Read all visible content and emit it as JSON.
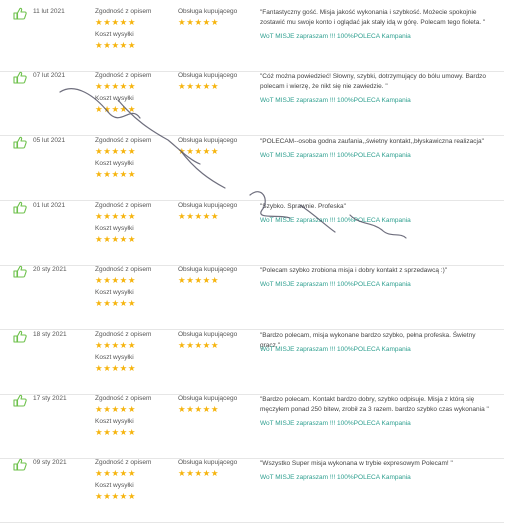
{
  "labels": {
    "accuracy": "Zgodność z opisem",
    "shipping": "Koszt wysyłki",
    "service": "Obsługa kupującego"
  },
  "stars": "★★★★★",
  "reviews": [
    {
      "date": "11 lut 2021",
      "comment": "\"Fantastyczny gość. Misja jakość wykonania i szybkość. Możecie spokojnie zostawić mu swoje konto i oglądać jak stały idą w górę. Polecam tego fioleta. \"",
      "campaign": "WoT MISJE zapraszam !!! 100%POLECA Kampania"
    },
    {
      "date": "07 lut 2021",
      "comment": "\"Cóż można powiedzieć! Słowny, szybki, dotrzymujący do bólu umowy. Bardzo polecam i wierzę, że nikt się nie zawiedzie. \"",
      "campaign": "WoT MISJE zapraszam !!! 100%POLECA Kampania"
    },
    {
      "date": "05 lut 2021",
      "comment": "\"POLECAM--osoba godna zaufania,,świetny kontakt,,błyskawiczna realizacja\"",
      "campaign": "WoT MISJE zapraszam !!! 100%POLECA Kampania"
    },
    {
      "date": "01 lut 2021",
      "comment": "\"Szybko. Sprawnie. Profeska\"",
      "campaign": "WoT MISJE zapraszam !!! 100%POLECA Kampania"
    },
    {
      "date": "20 sty 2021",
      "comment": "\"Polecam szybko zrobiona misja i dobry kontakt z sprzedawcą :)\"",
      "campaign": "WoT MISJE zapraszam !!! 100%POLECA Kampania"
    },
    {
      "date": "18 sty 2021",
      "comment": "\"Bardzo polecam, misja wykonane bardzo szybko, pełna profeska. Świetny gracz.\"",
      "campaign": "WoT MISJE zapraszam !!! 100%POLECA Kampania"
    },
    {
      "date": "17 sty 2021",
      "comment": "\"Bardzo polecam. Kontakt bardzo dobry, szybko odpisuje. Misja z którą się męczyłem ponad 250 bitew, zrobił za 3 razem. bardzo szybko czas wykonania \"",
      "campaign": "WoT MISJE zapraszam !!! 100%POLECA Kampania"
    },
    {
      "date": "09 sty 2021",
      "comment": "\"Wszystko Super misja wykonana w trybie expresowym Polecam! \"",
      "campaign": "WoT MISJE zapraszam !!! 100%POLECA Kampania"
    }
  ],
  "colors": {
    "star": "#f6b40e",
    "thumb": "#6cc04a",
    "campaign": "#2e9f8f"
  },
  "icons": {
    "thumb": "thumbs-up-icon",
    "star": "star-icon"
  }
}
